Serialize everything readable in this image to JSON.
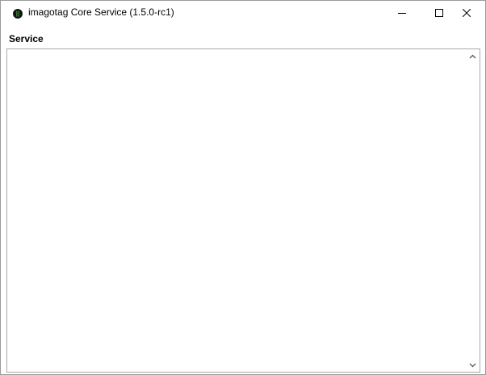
{
  "window": {
    "title": "imagotag Core Service (1.5.0-rc1)",
    "icon": "imagotag-app-icon",
    "controls": {
      "minimize": "minimize-icon",
      "maximize": "maximize-icon",
      "close": "close-icon"
    }
  },
  "menubar": {
    "items": [
      {
        "label": "Service"
      }
    ]
  },
  "content": {
    "log_text": ""
  },
  "scrollbar": {
    "up": "chevron-up-icon",
    "down": "chevron-down-icon"
  },
  "colors": {
    "window_border": "#9a9a9a",
    "client_border": "#a8a8a8",
    "background": "#ffffff",
    "icon_dark": "#141414",
    "icon_accent": "#3b8a3b"
  }
}
